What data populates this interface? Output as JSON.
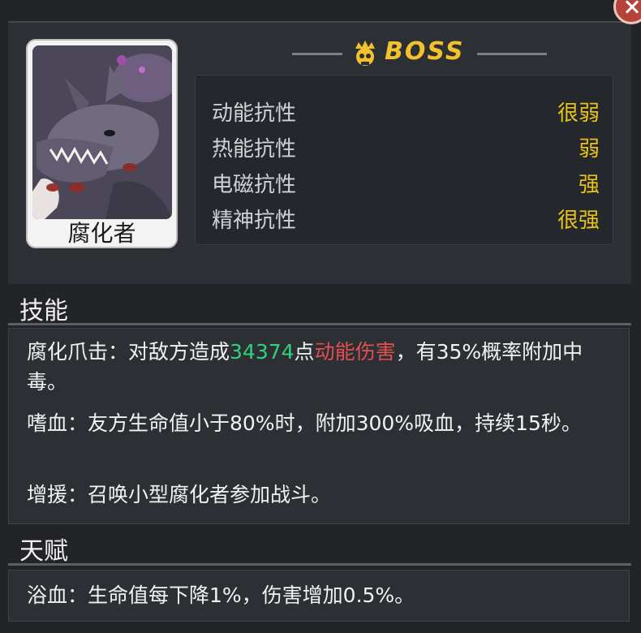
{
  "portrait": {
    "name": "腐化者"
  },
  "boss": {
    "label": "BOSS",
    "color": "#f2c12c"
  },
  "resistances": [
    {
      "label": "动能抗性",
      "value": "很弱"
    },
    {
      "label": "热能抗性",
      "value": "弱"
    },
    {
      "label": "电磁抗性",
      "value": "强"
    },
    {
      "label": "精神抗性",
      "value": "很强"
    }
  ],
  "skills": {
    "title": "技能",
    "items": [
      {
        "prefix": "腐化爪击：对敌方造成",
        "damage": "34374",
        "mid": "点",
        "damage_type": "动能伤害",
        "suffix": "，有35%概率附加中毒。"
      },
      {
        "text": "嗜血：友方生命值小于80%时，附加300%吸血，持续15秒。"
      },
      {
        "text": "增援：召唤小型腐化者参加战斗。"
      }
    ]
  },
  "talent": {
    "title": "天赋",
    "text": "浴血：生命值每下降1%，伤害增加0.5%。"
  },
  "colors": {
    "damage_number": "#2fd27a",
    "damage_type": "#e34f4f",
    "resist_value": "#e8c21a"
  }
}
